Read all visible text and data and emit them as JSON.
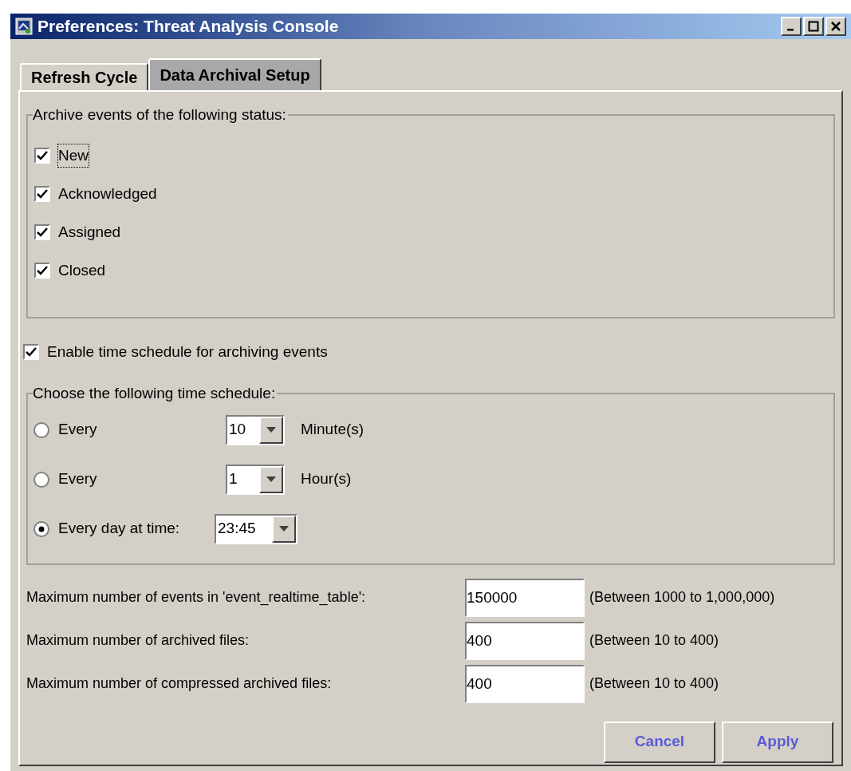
{
  "window": {
    "title": "Preferences: Threat Analysis Console"
  },
  "tabs": [
    {
      "label": "Refresh Cycle",
      "selected": false
    },
    {
      "label": "Data Archival Setup",
      "selected": true
    }
  ],
  "status_group": {
    "legend": "Archive events of the following status:",
    "items": [
      {
        "label": "New",
        "checked": true,
        "focused": true
      },
      {
        "label": "Acknowledged",
        "checked": true,
        "focused": false
      },
      {
        "label": "Assigned",
        "checked": true,
        "focused": false
      },
      {
        "label": "Closed",
        "checked": true,
        "focused": false
      }
    ]
  },
  "enable_schedule": {
    "label": "Enable time schedule for archiving events",
    "checked": true
  },
  "schedule_group": {
    "legend": "Choose the following time schedule:",
    "options": [
      {
        "label": "Every",
        "value": "10",
        "unit": "Minute(s)",
        "selected": false
      },
      {
        "label": "Every",
        "value": "1",
        "unit": "Hour(s)",
        "selected": false
      },
      {
        "label": "Every day at time:",
        "value": "23:45",
        "selected": true
      }
    ]
  },
  "limits": [
    {
      "label": "Maximum number of events in 'event_realtime_table':",
      "value": "150000",
      "range": "(Between 1000 to 1,000,000)"
    },
    {
      "label": "Maximum number of archived files:",
      "value": "400",
      "range": "(Between 10 to 400)"
    },
    {
      "label": "Maximum number of compressed archived files:",
      "value": "400",
      "range": "(Between 10 to 400)"
    }
  ],
  "buttons": [
    "Cancel",
    "Apply"
  ]
}
